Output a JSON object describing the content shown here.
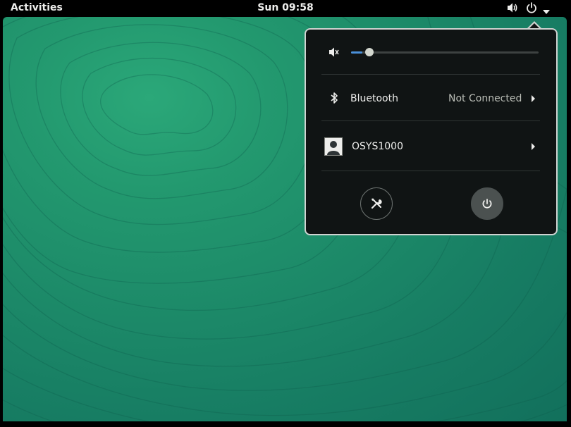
{
  "topbar": {
    "activities_label": "Activities",
    "clock": "Sun 09:58",
    "volume_icon": "speaker-volume-icon",
    "power_icon": "power-icon",
    "menu_caret_icon": "chevron-down-icon"
  },
  "system_menu": {
    "volume": {
      "icon": "speaker-muted-icon",
      "level": 0.06
    },
    "bluetooth": {
      "icon": "bluetooth-icon",
      "label": "Bluetooth",
      "status": "Not Connected"
    },
    "user": {
      "icon": "avatar-icon",
      "label": "OSYS1000"
    },
    "buttons": {
      "settings_icon": "settings-tools-icon",
      "power_icon": "power-icon"
    }
  },
  "colors": {
    "desktop_green": "#1d8b69",
    "panel_bg": "#101414",
    "slider_fill": "#4a90d9"
  }
}
